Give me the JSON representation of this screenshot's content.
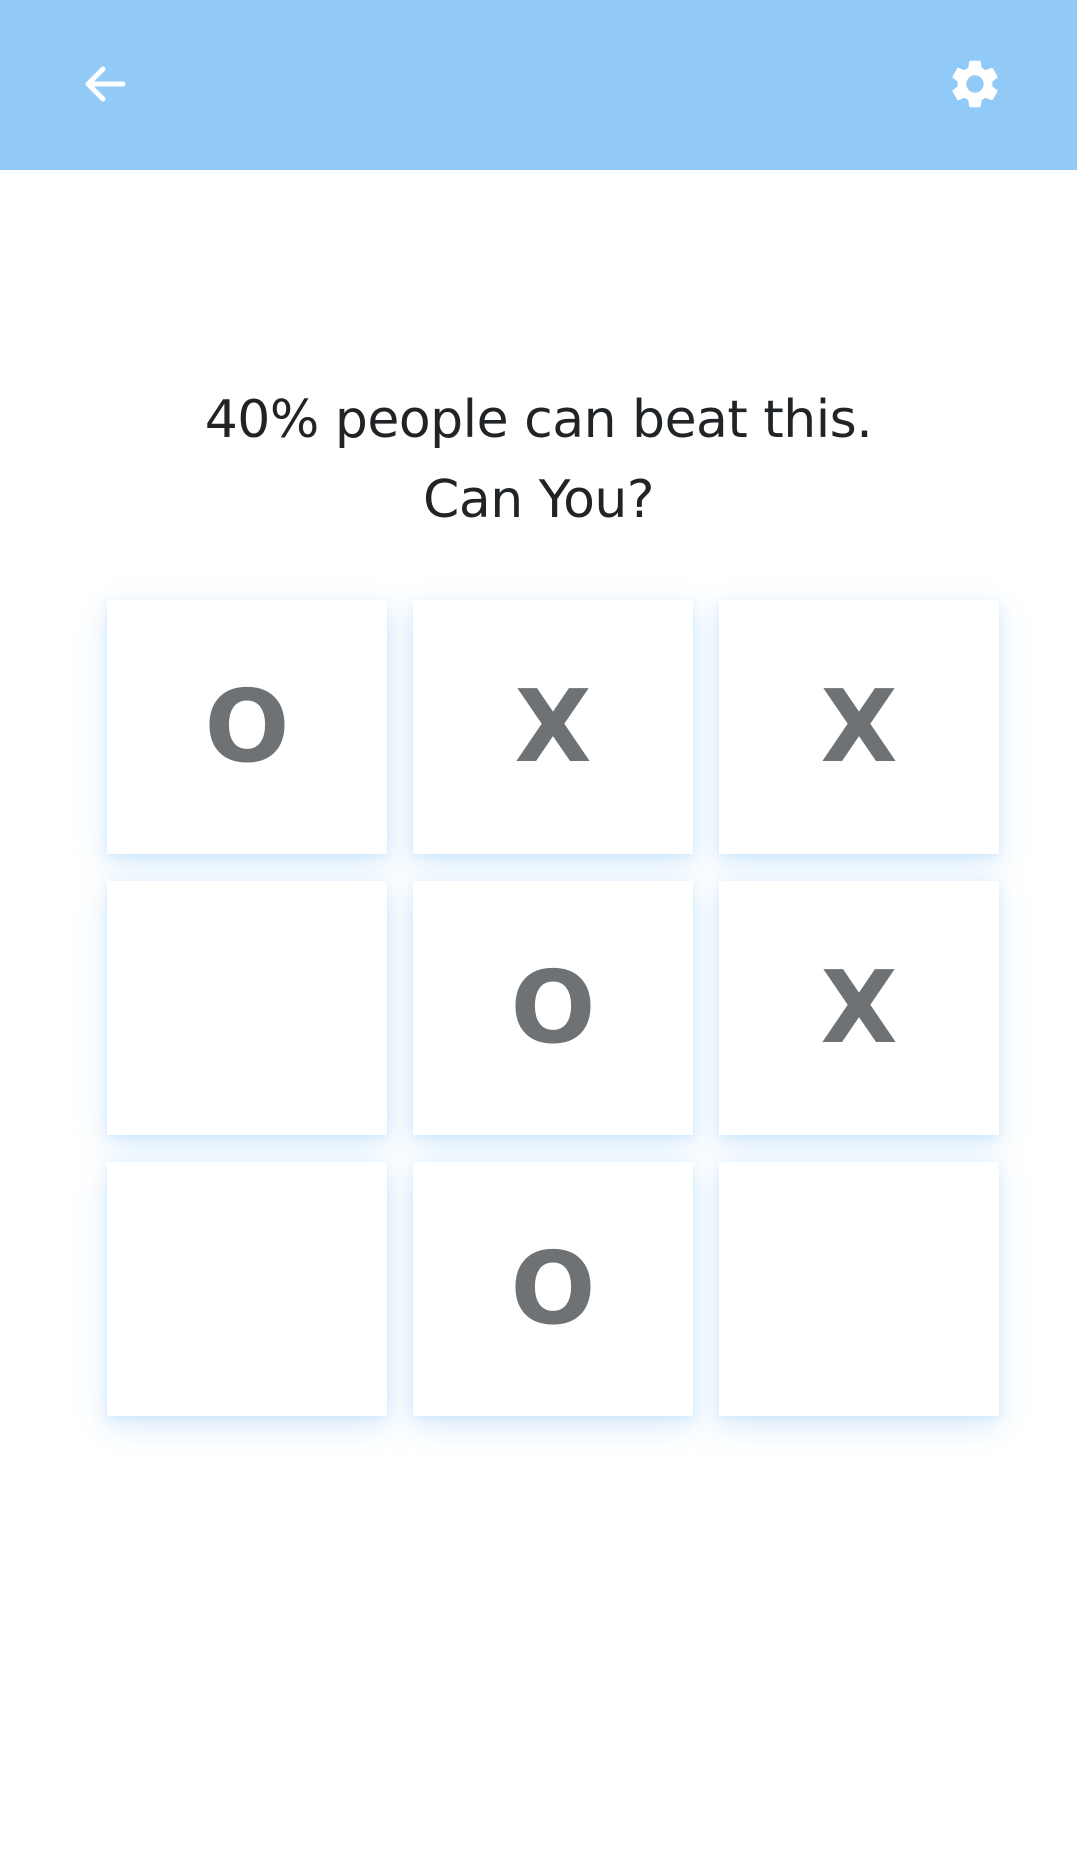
{
  "colors": {
    "appbar": "#92caf7",
    "mark": "#6f7275",
    "headline": "#212427"
  },
  "appbar": {
    "back_icon": "arrow-back-icon",
    "settings_icon": "gear-icon"
  },
  "headline": {
    "line1": "40% people can beat this.",
    "line2": "Can You?"
  },
  "board": {
    "cells": [
      "O",
      "X",
      "X",
      "",
      "O",
      "X",
      "",
      "O",
      ""
    ]
  }
}
